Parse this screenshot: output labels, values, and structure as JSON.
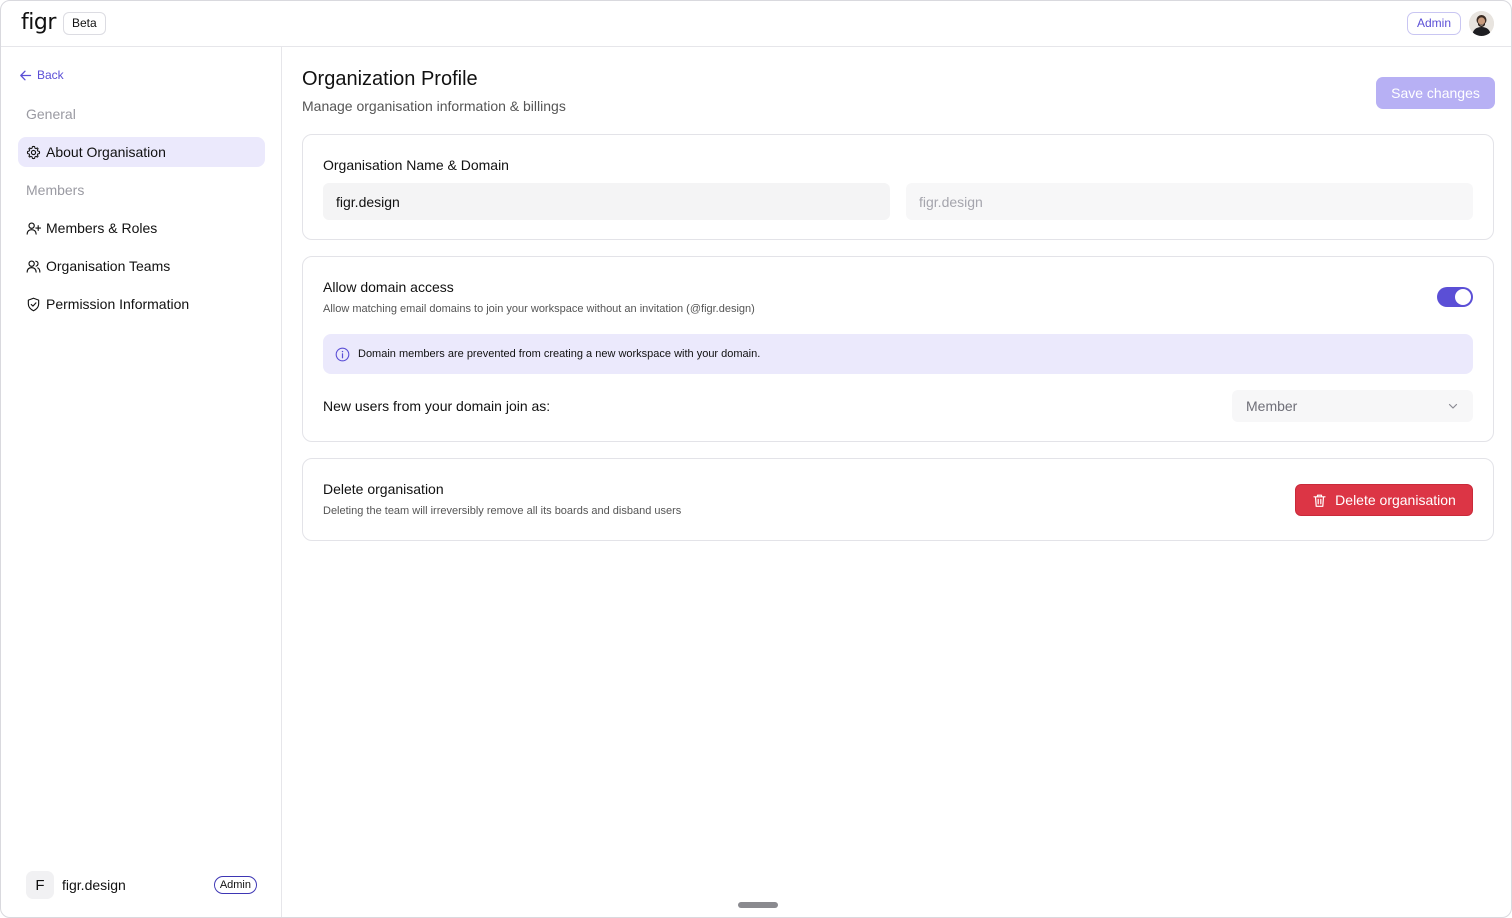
{
  "header": {
    "logo_text": "figr",
    "beta_label": "Beta",
    "role_badge": "Admin",
    "avatar_icon": "user-avatar"
  },
  "sidebar": {
    "back_label": "Back",
    "sections": [
      {
        "label": "General",
        "items": [
          {
            "label": "About Organisation",
            "icon": "gear-icon",
            "active": true
          }
        ]
      },
      {
        "label": "Members",
        "items": [
          {
            "label": "Members & Roles",
            "icon": "user-plus-icon",
            "active": false
          },
          {
            "label": "Organisation Teams",
            "icon": "users-icon",
            "active": false
          },
          {
            "label": "Permission Information",
            "icon": "shield-check-icon",
            "active": false
          }
        ]
      }
    ],
    "footer": {
      "org_initial": "F",
      "org_name": "figr.design",
      "role_badge": "Admin"
    }
  },
  "main": {
    "title": "Organization Profile",
    "subtitle": "Manage organisation information & billings",
    "save_label": "Save changes",
    "name_card": {
      "title": "Organisation Name & Domain",
      "name_value": "figr.design",
      "domain_placeholder": "figr.design"
    },
    "domain_card": {
      "title": "Allow domain access",
      "description": "Allow matching email domains to join your workspace without an invitation (@figr.design)",
      "toggle_on": true,
      "info_text": "Domain members are prevented from creating a new workspace with your domain.",
      "join_label": "New users from your domain join as:",
      "join_role": "Member"
    },
    "delete_card": {
      "title": "Delete organisation",
      "description": "Deleting the team will irreversibly remove all its boards and disband users",
      "button_label": "Delete organisation"
    }
  },
  "colors": {
    "accent": "#5b4fd6",
    "accent_light": "#ebe9fc",
    "save_disabled": "#b7b0f4",
    "danger": "#dc3545"
  }
}
